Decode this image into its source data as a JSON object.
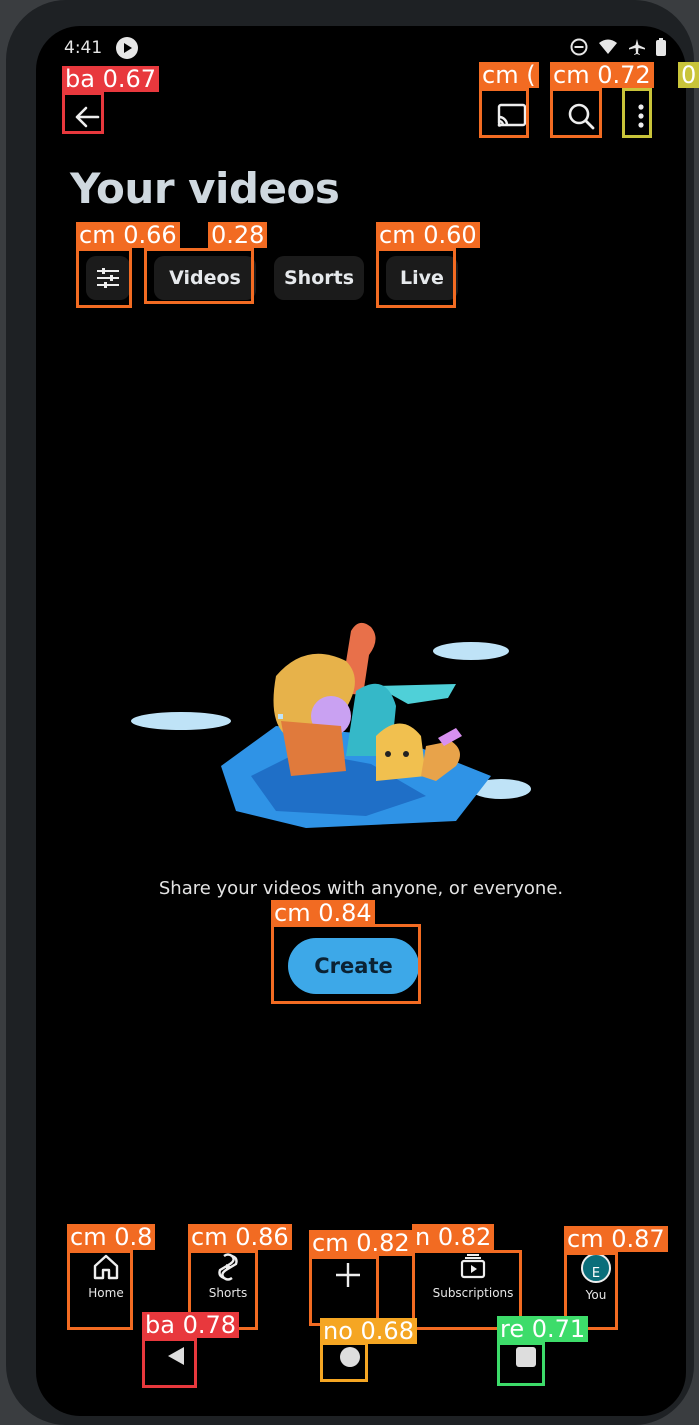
{
  "status_bar": {
    "time": "4:41"
  },
  "header": {
    "title": "Your videos"
  },
  "filters": {
    "tabs": [
      "Videos",
      "Shorts",
      "Live"
    ]
  },
  "empty_state": {
    "message": "Share your videos with anyone, or everyone.",
    "create_label": "Create"
  },
  "bottom_nav": {
    "home": "Home",
    "shorts": "Shorts",
    "subscriptions": "Subscriptions",
    "you": "You",
    "avatar_letter": "E"
  },
  "annotations": [
    {
      "text": "ba  0.67",
      "color": "#e8383d"
    },
    {
      "text": "cm  (",
      "color": "#f26b22"
    },
    {
      "text": "cm  0.72",
      "color": "#f26b22"
    },
    {
      "text": "0",
      "color": "#c9c43a"
    },
    {
      "text": "cm  0.66",
      "color": "#f26b22"
    },
    {
      "text": "0.28",
      "color": "#f26b22"
    },
    {
      "text": "cm  0.60",
      "color": "#f26b22"
    },
    {
      "text": "cm  0.84",
      "color": "#f26b22"
    },
    {
      "text": "cm  0.8",
      "color": "#f26b22"
    },
    {
      "text": "cm  0.86",
      "color": "#f26b22"
    },
    {
      "text": "cm  0.82",
      "color": "#f26b22"
    },
    {
      "text": "n  0.82",
      "color": "#f26b22"
    },
    {
      "text": "cm  0.87",
      "color": "#f26b22"
    },
    {
      "text": "ba  0.78",
      "color": "#e8383d"
    },
    {
      "text": "no  0.68",
      "color": "#f5a623"
    },
    {
      "text": "re  0.71",
      "color": "#3ddc6a"
    }
  ]
}
